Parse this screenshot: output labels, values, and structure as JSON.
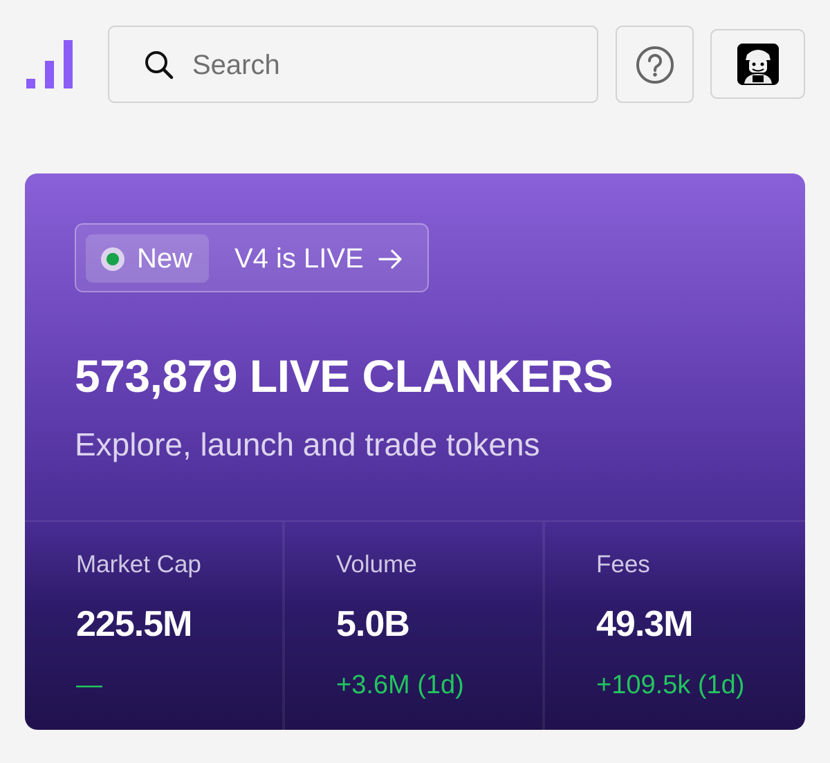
{
  "header": {
    "logo_icon": "bar-chart-logo-icon",
    "search": {
      "placeholder": "Search",
      "value": "",
      "icon": "search-icon"
    },
    "help_icon": "question-circle-icon",
    "avatar_icon": "user-avatar"
  },
  "announcement": {
    "badge_label": "New",
    "badge_status_color": "#17a34a",
    "text": "V4 is LIVE",
    "arrow_icon": "arrow-right-icon"
  },
  "hero": {
    "headline": "573,879 LIVE CLANKERS",
    "subtitle": "Explore, launch and trade tokens"
  },
  "stats": [
    {
      "label": "Market Cap",
      "value": "225.5M",
      "change": "—"
    },
    {
      "label": "Volume",
      "value": "5.0B",
      "change": "+3.6M (1d)"
    },
    {
      "label": "Fees",
      "value": "49.3M",
      "change": "+109.5k (1d)"
    }
  ],
  "colors": {
    "accent": "#8a5cf6",
    "positive": "#22c55e",
    "hero_top": "#8a61d8",
    "hero_bottom": "#20124d"
  }
}
